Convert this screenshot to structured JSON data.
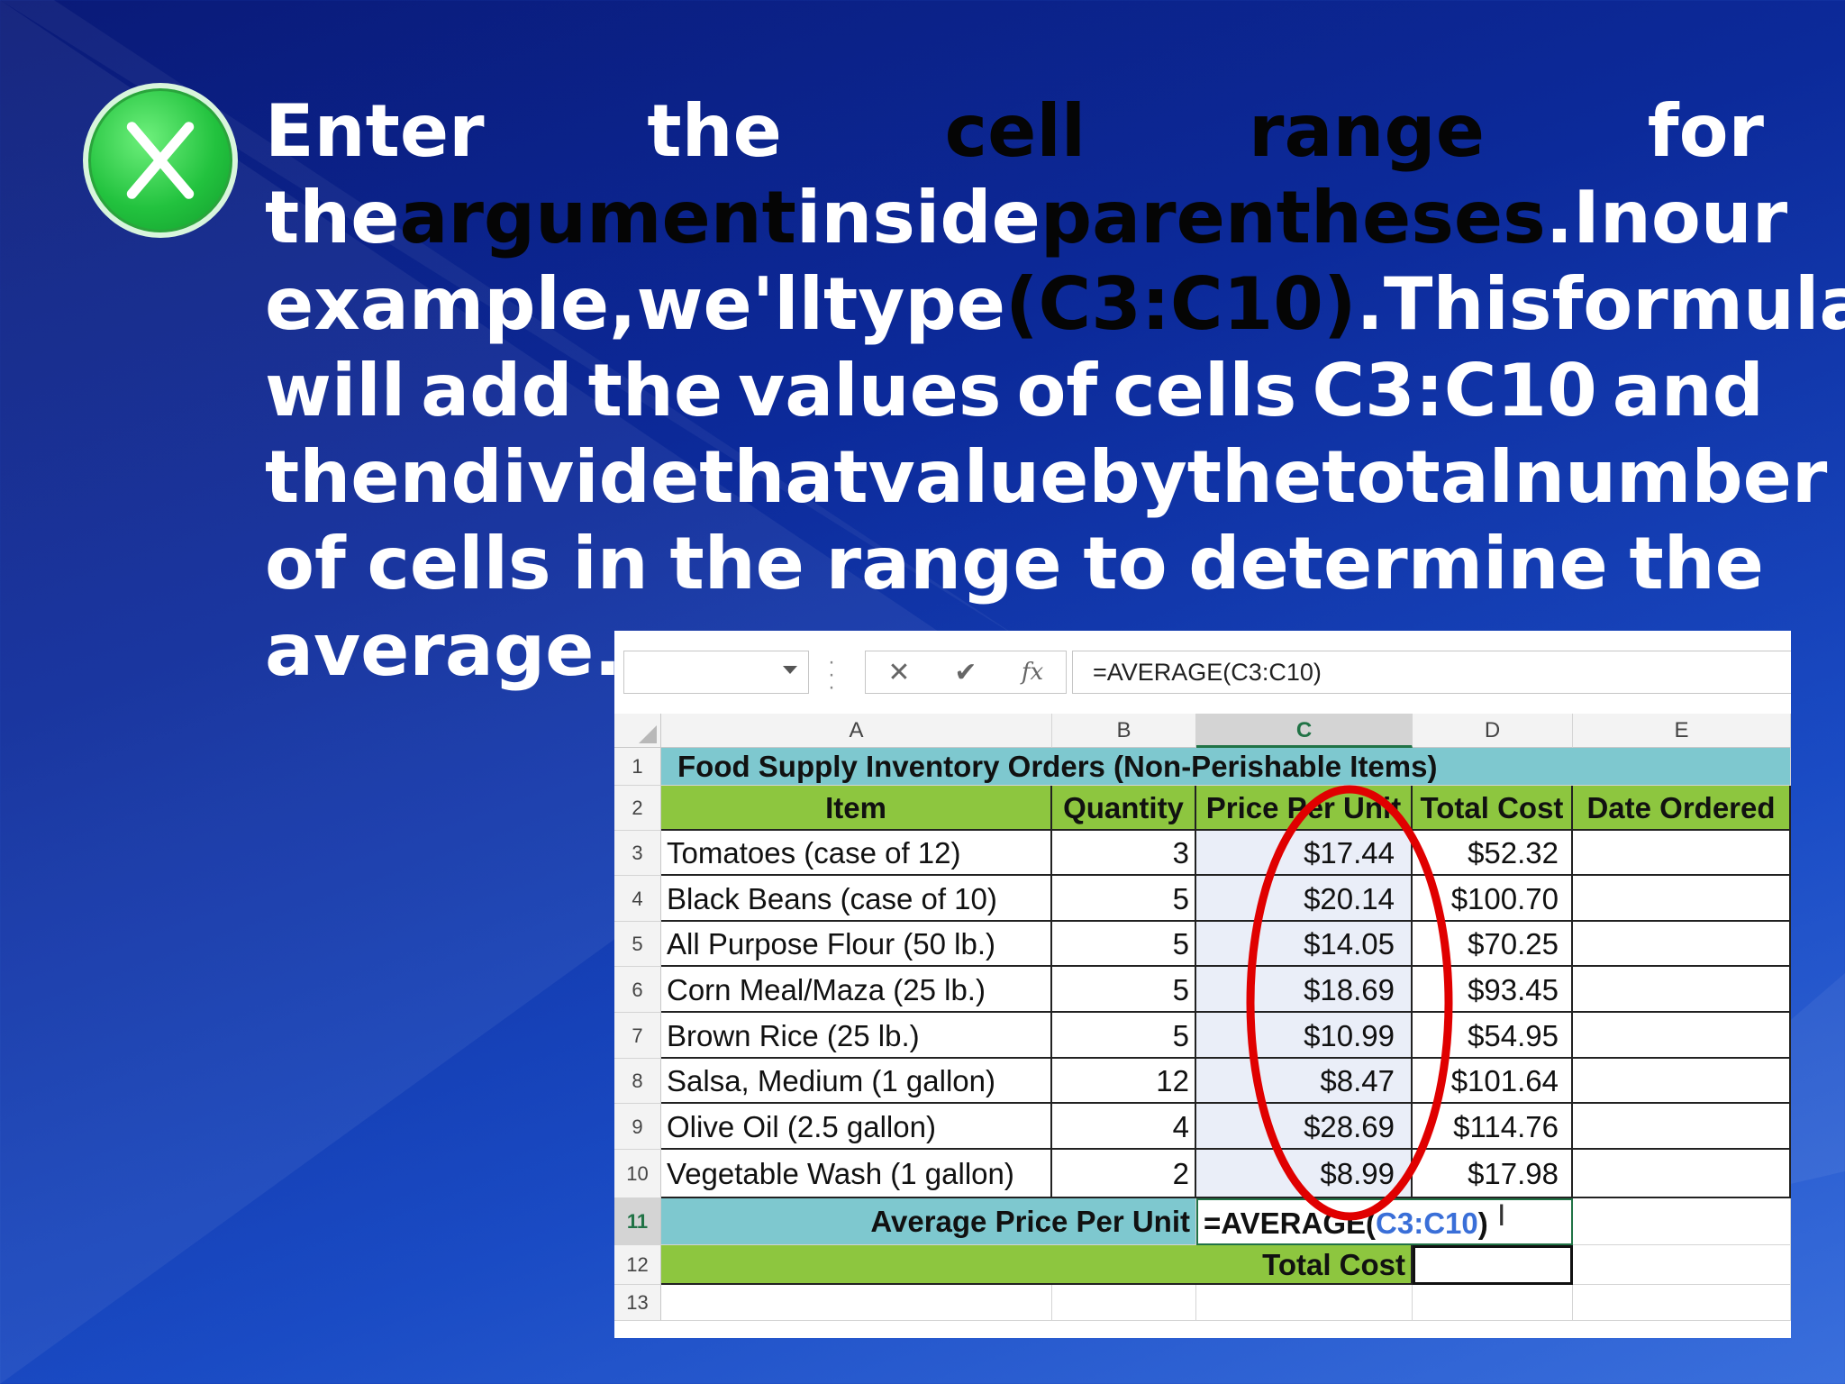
{
  "slide": {
    "lines": [
      [
        {
          "t": "Enter"
        },
        {
          "t": "the"
        },
        {
          "t": "cell",
          "dark": true
        },
        {
          "t": "range",
          "dark": true
        },
        {
          "t": "for"
        }
      ],
      [
        {
          "t": "the"
        },
        {
          "t": "argument",
          "dark": true
        },
        {
          "t": "inside"
        },
        {
          "t": "parentheses",
          "dark": true,
          "suffix": "."
        },
        {
          "t": "In"
        },
        {
          "t": "our"
        }
      ],
      [
        {
          "t": "example,"
        },
        {
          "t": "we'll"
        },
        {
          "t": "type"
        },
        {
          "t": "(C3:C10)",
          "dark": true,
          "suffix": "."
        },
        {
          "t": "This"
        },
        {
          "t": "formula"
        }
      ],
      [
        {
          "t": "will"
        },
        {
          "t": "add"
        },
        {
          "t": "the"
        },
        {
          "t": "values"
        },
        {
          "t": "of"
        },
        {
          "t": "cells"
        },
        {
          "t": "C3:C10"
        },
        {
          "t": "and"
        }
      ],
      [
        {
          "t": "then"
        },
        {
          "t": "divide"
        },
        {
          "t": "that"
        },
        {
          "t": "value"
        },
        {
          "t": "by"
        },
        {
          "t": "the"
        },
        {
          "t": "total"
        },
        {
          "t": "number"
        }
      ],
      [
        {
          "t": "of"
        },
        {
          "t": "cells"
        },
        {
          "t": "in"
        },
        {
          "t": "the"
        },
        {
          "t": "range"
        },
        {
          "t": "to"
        },
        {
          "t": "determine"
        },
        {
          "t": "the"
        }
      ],
      [
        {
          "t": "average."
        }
      ]
    ]
  },
  "formula_bar": {
    "formula": "=AVERAGE(C3:C10)",
    "cancel_glyph": "✕",
    "enter_glyph": "✔",
    "fx_label": "fx"
  },
  "columns": [
    "A",
    "B",
    "C",
    "D",
    "E"
  ],
  "rows": [
    "1",
    "2",
    "3",
    "4",
    "5",
    "6",
    "7",
    "8",
    "9",
    "10",
    "11",
    "12",
    "13"
  ],
  "sheet": {
    "title": "Food Supply Inventory Orders (Non-Perishable Items)",
    "headers": [
      "Item",
      "Quantity",
      "Price Per Unit",
      "Total Cost",
      "Date Ordered"
    ],
    "data": [
      {
        "item": "Tomatoes (case of 12)",
        "qty": "3",
        "price": "$17.44",
        "total": "$52.32"
      },
      {
        "item": "Black Beans (case of 10)",
        "qty": "5",
        "price": "$20.14",
        "total": "$100.70"
      },
      {
        "item": "All Purpose Flour (50 lb.)",
        "qty": "5",
        "price": "$14.05",
        "total": "$70.25"
      },
      {
        "item": "Corn Meal/Maza (25 lb.)",
        "qty": "5",
        "price": "$18.69",
        "total": "$93.45"
      },
      {
        "item": "Brown Rice (25 lb.)",
        "qty": "5",
        "price": "$10.99",
        "total": "$54.95"
      },
      {
        "item": "Salsa, Medium (1 gallon)",
        "qty": "12",
        "price": "$8.47",
        "total": "$101.64"
      },
      {
        "item": "Olive Oil (2.5 gallon)",
        "qty": "4",
        "price": "$28.69",
        "total": "$114.76"
      },
      {
        "item": "Vegetable Wash (1 gallon)",
        "qty": "2",
        "price": "$8.99",
        "total": "$17.98"
      }
    ],
    "avg_label": "Average Price Per Unit",
    "avg_formula_prefix": "=AVERAGE(",
    "avg_formula_range": "C3:C10",
    "avg_formula_suffix": ")",
    "total_label": "Total Cost"
  },
  "colors": {
    "title_fill": "#7ec8cf",
    "header_fill": "#8dc63f",
    "annotation_ellipse": "#e00000"
  }
}
